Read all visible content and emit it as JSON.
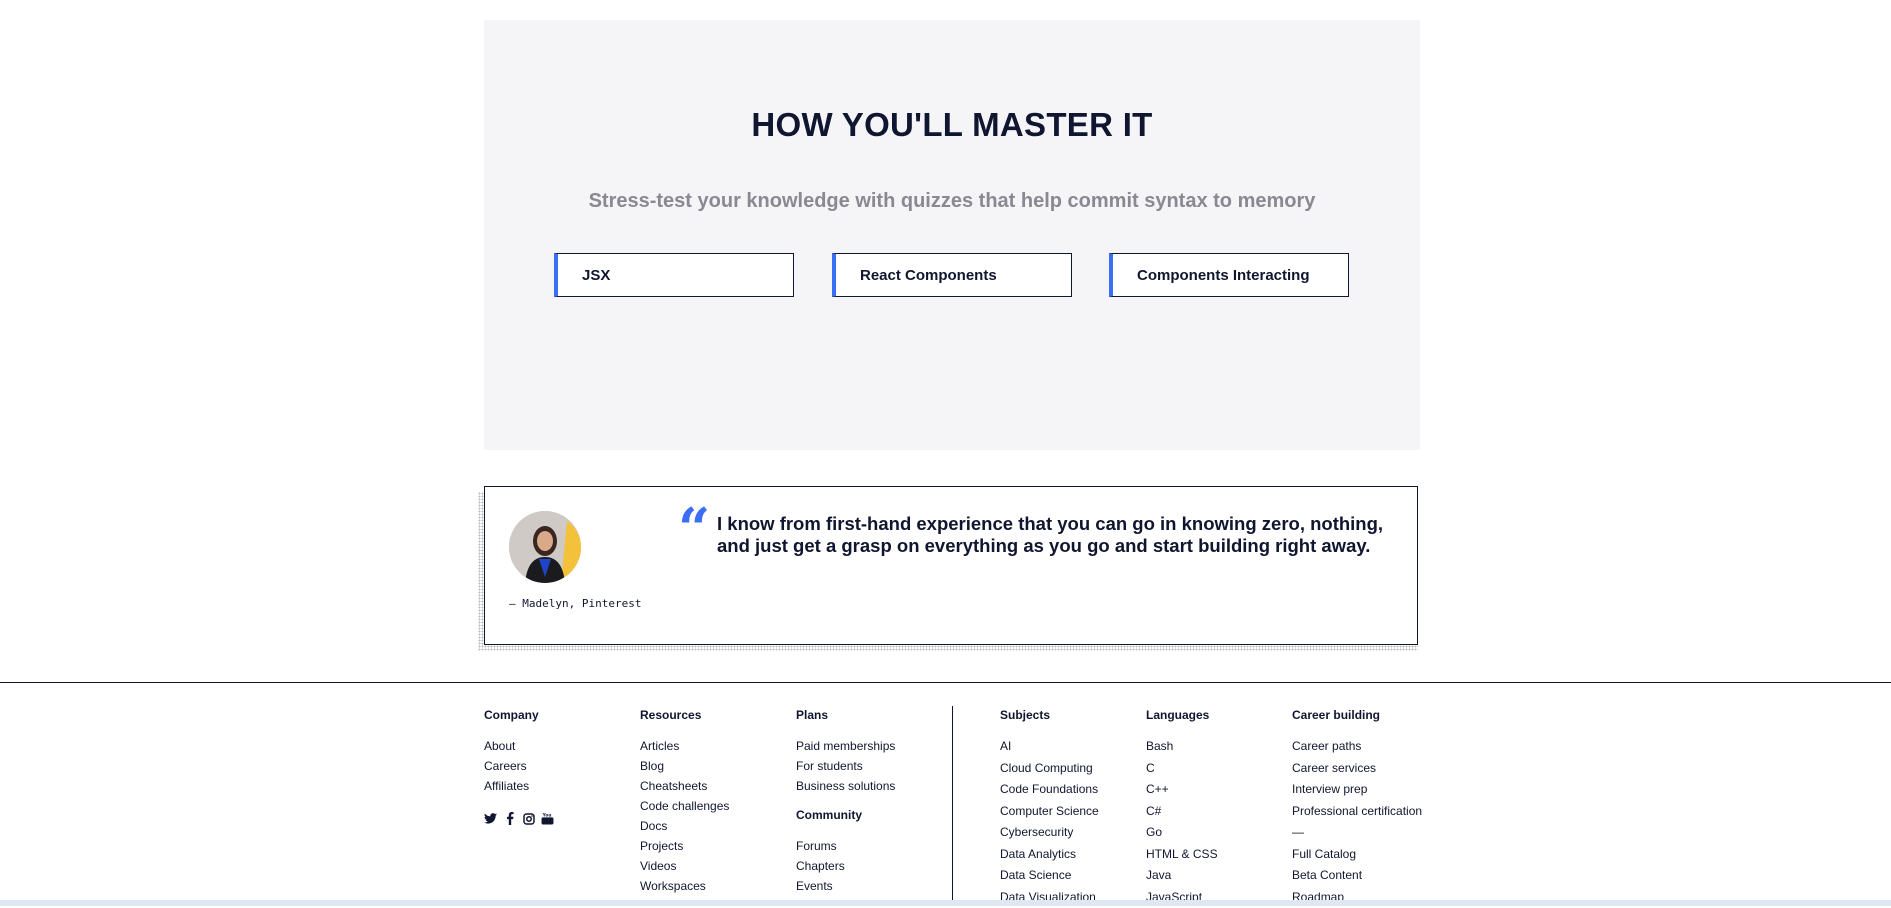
{
  "master": {
    "title": "HOW YOU'LL MASTER IT",
    "subtitle": "Stress-test your knowledge with quizzes that help commit syntax to memory",
    "cards": [
      "JSX",
      "React Components",
      "Components Interacting"
    ]
  },
  "testimonial": {
    "quote_mark": "“",
    "quote": "I know from first-hand experience that you can go in knowing zero, nothing, and just get a grasp on everything as you go and start building right away.",
    "author": "— Madelyn, Pinterest"
  },
  "footer": {
    "company": {
      "heading": "Company",
      "links": [
        "About",
        "Careers",
        "Affiliates"
      ]
    },
    "resources": {
      "heading": "Resources",
      "links": [
        "Articles",
        "Blog",
        "Cheatsheets",
        "Code challenges",
        "Docs",
        "Projects",
        "Videos",
        "Workspaces"
      ]
    },
    "plans": {
      "heading": "Plans",
      "links": [
        "Paid memberships",
        "For students",
        "Business solutions"
      ]
    },
    "community": {
      "heading": "Community",
      "links": [
        "Forums",
        "Chapters",
        "Events"
      ]
    },
    "subjects": {
      "heading": "Subjects",
      "links": [
        "AI",
        "Cloud Computing",
        "Code Foundations",
        "Computer Science",
        "Cybersecurity",
        "Data Analytics",
        "Data Science",
        "Data Visualization"
      ]
    },
    "languages": {
      "heading": "Languages",
      "links": [
        "Bash",
        "C",
        "C++",
        "C#",
        "Go",
        "HTML & CSS",
        "Java",
        "JavaScript"
      ]
    },
    "career": {
      "heading": "Career building",
      "links": [
        "Career paths",
        "Career services",
        "Interview prep",
        "Professional certification",
        "—",
        "Full Catalog",
        "Beta Content",
        "Roadmap"
      ]
    },
    "social_icons": [
      "twitter-icon",
      "facebook-icon",
      "instagram-icon",
      "youtube-icon"
    ]
  },
  "colors": {
    "accent": "#3a6ff5",
    "navy": "#10162f",
    "panel": "#f5f4f7",
    "muted": "#8a8992"
  }
}
